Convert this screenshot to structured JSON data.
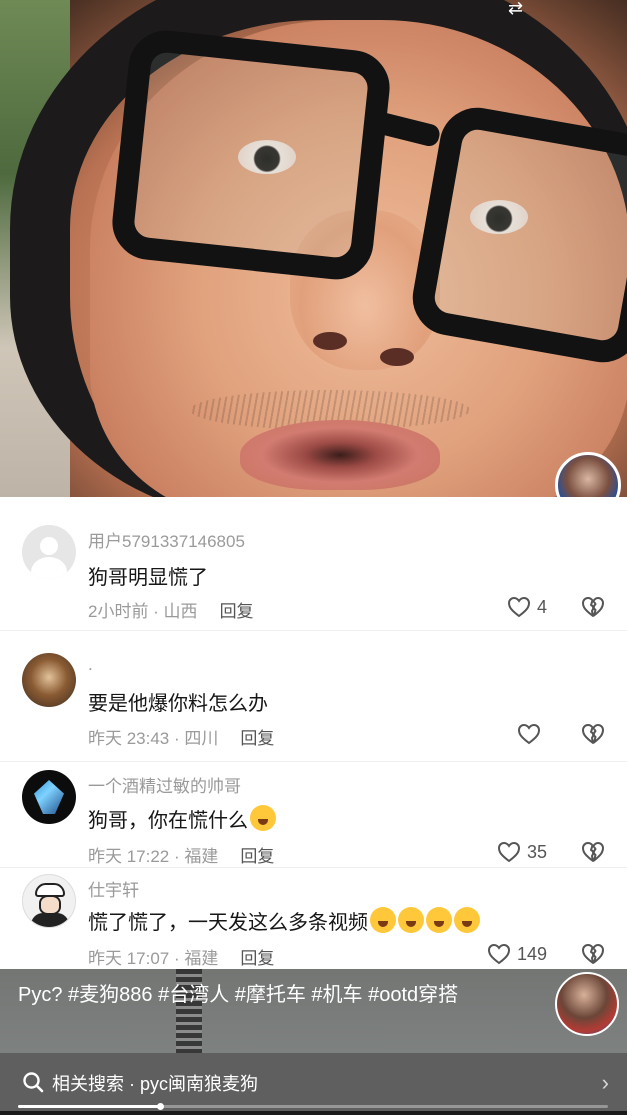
{
  "video": {
    "swap_icon": "⇄"
  },
  "comments": [
    {
      "user": "用户5791337146805",
      "text": "狗哥明显慌了",
      "time_location": "2小时前 · 山西",
      "reply": "回复",
      "likes": "4"
    },
    {
      "user": ".",
      "text": "要是他爆你料怎么办",
      "time_location": "昨天 23:43 · 四川",
      "reply": "回复",
      "likes": ""
    },
    {
      "user": "一个酒精过敏的帅哥",
      "text": "狗哥，你在慌什么",
      "time_location": "昨天 17:22 · 福建",
      "reply": "回复",
      "likes": "35"
    },
    {
      "user": "仕宇轩",
      "text": "慌了慌了，一天发这么多条视频",
      "time_location": "昨天 17:07 · 福建",
      "reply": "回复",
      "likes": "149"
    }
  ],
  "caption": {
    "text": "Pyc? #麦狗886 #台湾人 #摩托车 #机车 #ootd穿搭"
  },
  "search": {
    "label": "相关搜索 · pyc闽南狼麦狗",
    "chevron": "›"
  },
  "progress": {
    "fraction": 0.24
  },
  "colors": {
    "like_icon": "#555555",
    "meta_text": "#9a9a9a"
  }
}
